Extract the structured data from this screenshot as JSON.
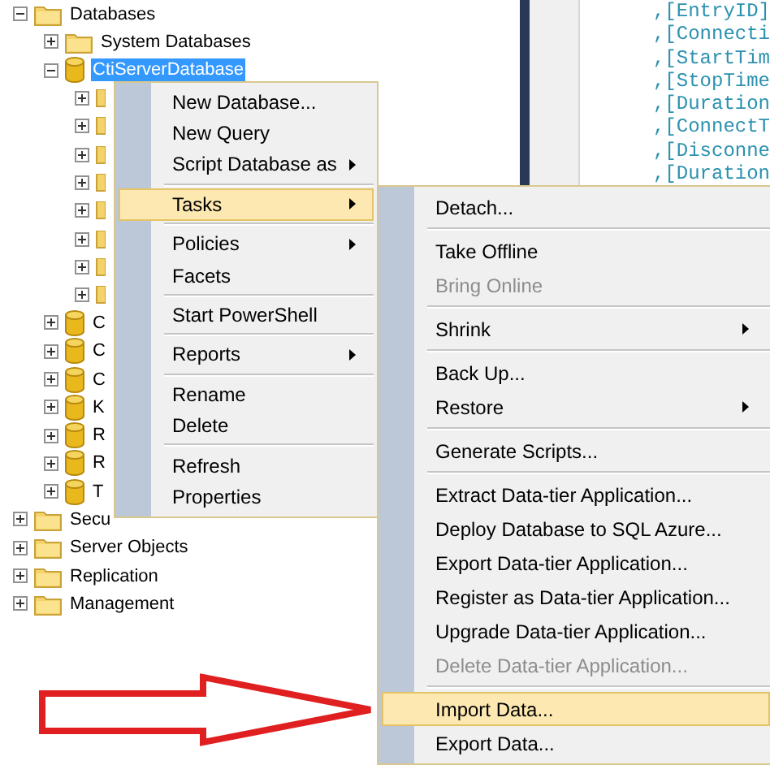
{
  "tree": [
    {
      "label": "Databases",
      "kind": "folder",
      "expanded": true,
      "selected": false,
      "children": [
        {
          "label": "System Databases",
          "kind": "folder",
          "expanded": false,
          "selected": false
        },
        {
          "label": "CtiServerDatabase",
          "kind": "database",
          "expanded": true,
          "selected": true,
          "children": [
            {
              "kind": "folder",
              "expanded": false
            },
            {
              "kind": "folder",
              "expanded": false
            },
            {
              "kind": "folder",
              "expanded": false
            },
            {
              "kind": "folder",
              "expanded": false
            },
            {
              "kind": "folder",
              "expanded": false
            },
            {
              "kind": "folder",
              "expanded": false
            },
            {
              "kind": "folder",
              "expanded": false
            },
            {
              "kind": "folder",
              "expanded": false
            }
          ]
        },
        {
          "label": "C",
          "kind": "database",
          "expanded": false,
          "selected": false
        },
        {
          "label": "C",
          "kind": "database",
          "expanded": false,
          "selected": false
        },
        {
          "label": "C",
          "kind": "database",
          "expanded": false,
          "selected": false
        },
        {
          "label": "K",
          "kind": "database",
          "expanded": false,
          "selected": false
        },
        {
          "label": "R",
          "kind": "database",
          "expanded": false,
          "selected": false
        },
        {
          "label": "R",
          "kind": "database",
          "expanded": false,
          "selected": false
        },
        {
          "label": "T",
          "kind": "database",
          "expanded": false,
          "selected": false
        }
      ]
    },
    {
      "label": "Secu",
      "kind": "folder",
      "expanded": false,
      "selected": false
    },
    {
      "label": "Server Objects",
      "kind": "folder",
      "expanded": false,
      "selected": false
    },
    {
      "label": "Replication",
      "kind": "folder",
      "expanded": false,
      "selected": false
    },
    {
      "label": "Management",
      "kind": "folder",
      "expanded": false,
      "selected": false
    }
  ],
  "editor": {
    "lines": [
      ",[EntryID]",
      ",[Connecti",
      ",[StartTim",
      ",[StopTime",
      ",[Duration",
      ",[ConnectT",
      ",[Disconne",
      ",[Duration"
    ]
  },
  "context_menu": {
    "items": [
      {
        "kind": "item",
        "label": "New Database...",
        "arrow": false,
        "selected": false
      },
      {
        "kind": "item",
        "label": "New Query",
        "arrow": false,
        "selected": false
      },
      {
        "kind": "item",
        "label": "Script Database as",
        "arrow": true,
        "selected": false
      },
      {
        "kind": "separator"
      },
      {
        "kind": "item",
        "label": "Tasks",
        "arrow": true,
        "selected": true
      },
      {
        "kind": "separator"
      },
      {
        "kind": "item",
        "label": "Policies",
        "arrow": true,
        "selected": false
      },
      {
        "kind": "item",
        "label": "Facets",
        "arrow": false,
        "selected": false
      },
      {
        "kind": "separator"
      },
      {
        "kind": "item",
        "label": "Start PowerShell",
        "arrow": false,
        "selected": false
      },
      {
        "kind": "separator"
      },
      {
        "kind": "item",
        "label": "Reports",
        "arrow": true,
        "selected": false
      },
      {
        "kind": "separator"
      },
      {
        "kind": "item",
        "label": "Rename",
        "arrow": false,
        "selected": false
      },
      {
        "kind": "item",
        "label": "Delete",
        "arrow": false,
        "selected": false
      },
      {
        "kind": "separator"
      },
      {
        "kind": "item",
        "label": "Refresh",
        "arrow": false,
        "selected": false
      },
      {
        "kind": "item",
        "label": "Properties",
        "arrow": false,
        "selected": false
      }
    ]
  },
  "submenu": {
    "items": [
      {
        "kind": "item",
        "label": "Detach...",
        "arrow": false,
        "selected": false,
        "disabled": false
      },
      {
        "kind": "separator"
      },
      {
        "kind": "item",
        "label": "Take Offline",
        "arrow": false,
        "selected": false,
        "disabled": false
      },
      {
        "kind": "item",
        "label": "Bring Online",
        "arrow": false,
        "selected": false,
        "disabled": true
      },
      {
        "kind": "separator"
      },
      {
        "kind": "item",
        "label": "Shrink",
        "arrow": true,
        "selected": false,
        "disabled": false
      },
      {
        "kind": "separator"
      },
      {
        "kind": "item",
        "label": "Back Up...",
        "arrow": false,
        "selected": false,
        "disabled": false
      },
      {
        "kind": "item",
        "label": "Restore",
        "arrow": true,
        "selected": false,
        "disabled": false
      },
      {
        "kind": "separator"
      },
      {
        "kind": "item",
        "label": "Generate Scripts...",
        "arrow": false,
        "selected": false,
        "disabled": false
      },
      {
        "kind": "separator"
      },
      {
        "kind": "item",
        "label": "Extract Data-tier Application...",
        "arrow": false,
        "selected": false,
        "disabled": false
      },
      {
        "kind": "item",
        "label": "Deploy Database to SQL Azure...",
        "arrow": false,
        "selected": false,
        "disabled": false
      },
      {
        "kind": "item",
        "label": "Export Data-tier Application...",
        "arrow": false,
        "selected": false,
        "disabled": false
      },
      {
        "kind": "item",
        "label": "Register as Data-tier Application...",
        "arrow": false,
        "selected": false,
        "disabled": false
      },
      {
        "kind": "item",
        "label": "Upgrade Data-tier Application...",
        "arrow": false,
        "selected": false,
        "disabled": false
      },
      {
        "kind": "item",
        "label": "Delete Data-tier Application...",
        "arrow": false,
        "selected": false,
        "disabled": true
      },
      {
        "kind": "separator"
      },
      {
        "kind": "item",
        "label": "Import Data...",
        "arrow": false,
        "selected": true,
        "disabled": false
      },
      {
        "kind": "item",
        "label": "Export Data...",
        "arrow": false,
        "selected": false,
        "disabled": false
      }
    ]
  }
}
